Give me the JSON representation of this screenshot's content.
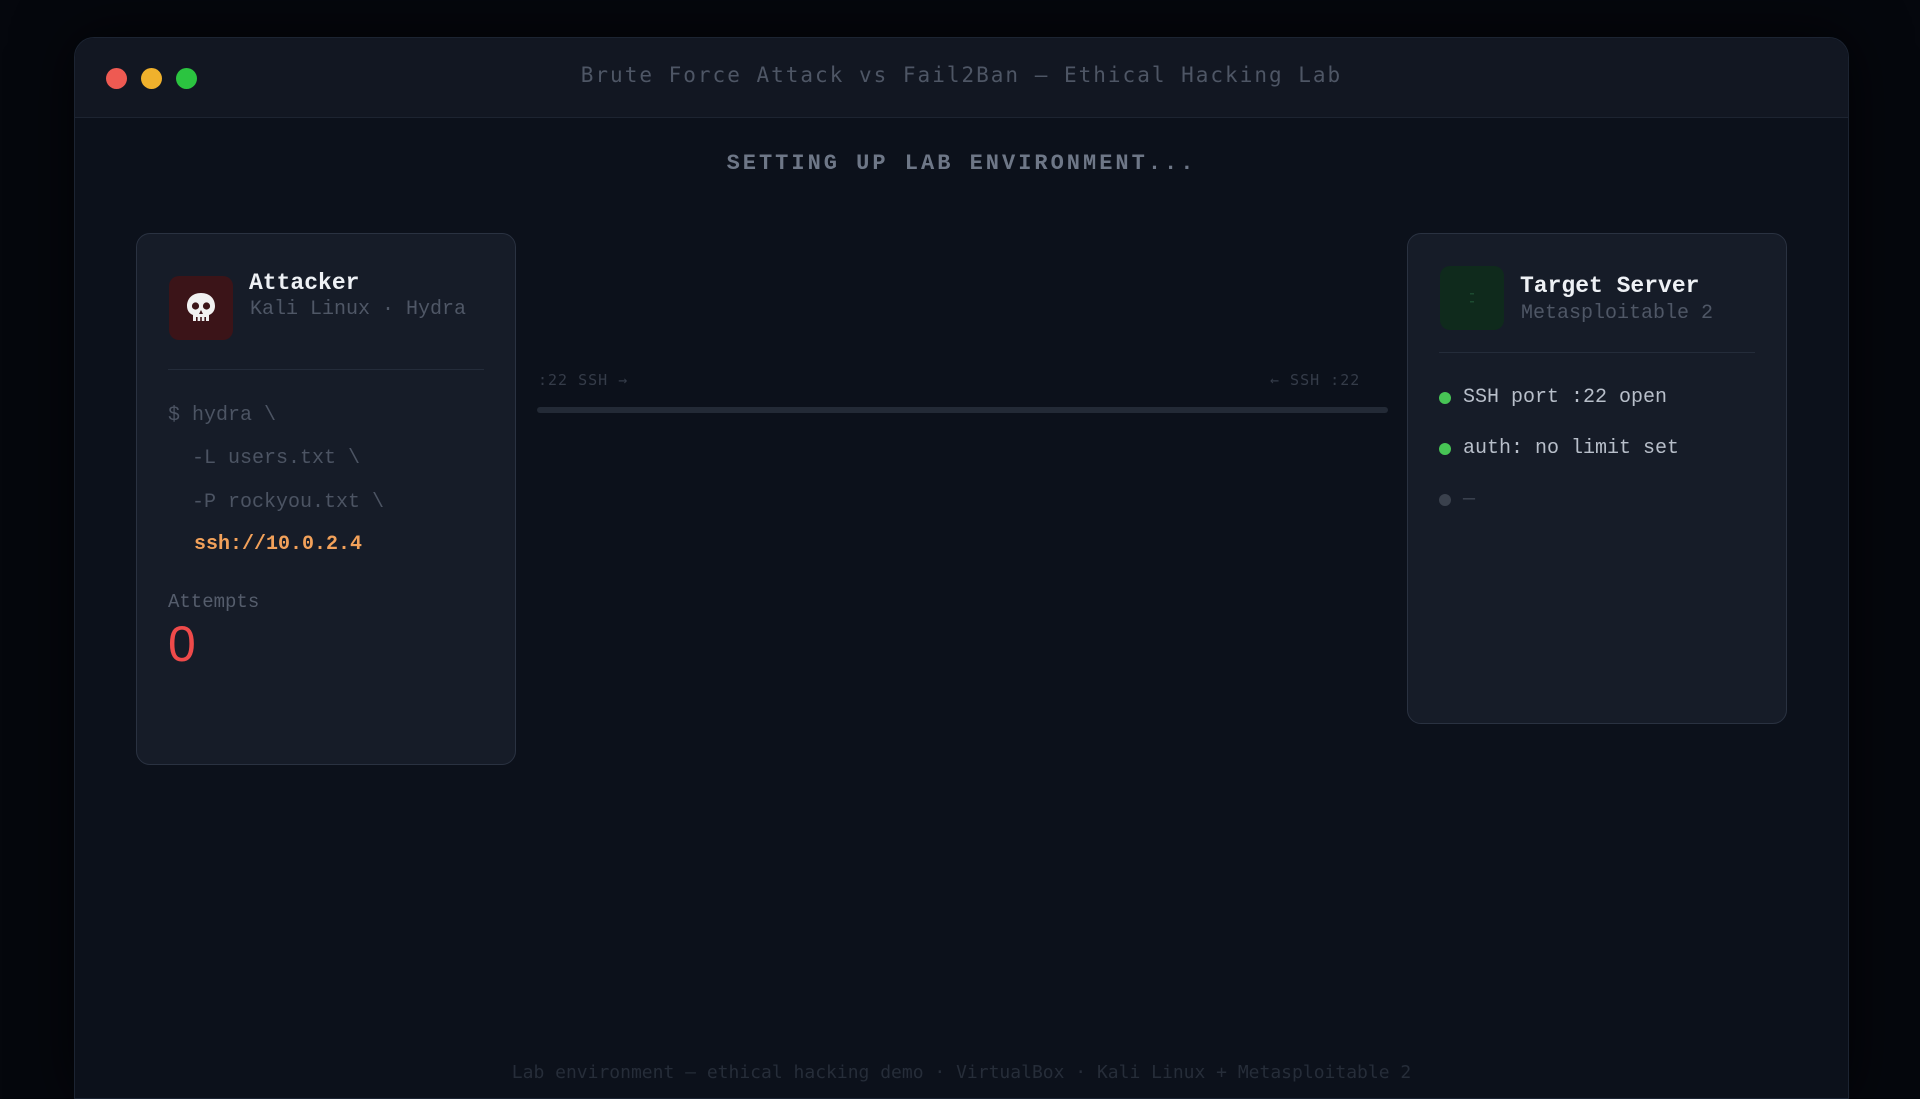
{
  "window": {
    "title": "Brute Force Attack vs Fail2Ban — Ethical Hacking Lab"
  },
  "stage": {
    "heading": "SETTING UP LAB ENVIRONMENT..."
  },
  "attacker": {
    "title": "Attacker",
    "subtitle": "Kali Linux · Hydra",
    "icon": "skull-icon",
    "command": {
      "line1": "$ hydra \\",
      "line2": "  -L users.txt \\",
      "line3": "  -P rockyou.txt \\",
      "target": "ssh://10.0.2.4"
    },
    "attempts_label": "Attempts",
    "attempts_value": "0"
  },
  "target": {
    "title": "Target Server",
    "subtitle": "Metasploitable 2",
    "icon": "server-icon",
    "status": [
      {
        "text": "SSH port :22 open",
        "state": "green"
      },
      {
        "text": "auth: no limit set",
        "state": "green"
      },
      {
        "text": "—",
        "state": "gray"
      }
    ]
  },
  "link": {
    "left_label": ":22 SSH →",
    "right_label": "← SSH :22"
  },
  "footer": {
    "text": "Lab environment — ethical hacking demo · VirtualBox · Kali Linux + Metasploitable 2"
  },
  "colors": {
    "accent_red": "#ef4a4a",
    "accent_orange": "#f2a15a",
    "status_green": "#47c455",
    "background": "#0c111b"
  }
}
